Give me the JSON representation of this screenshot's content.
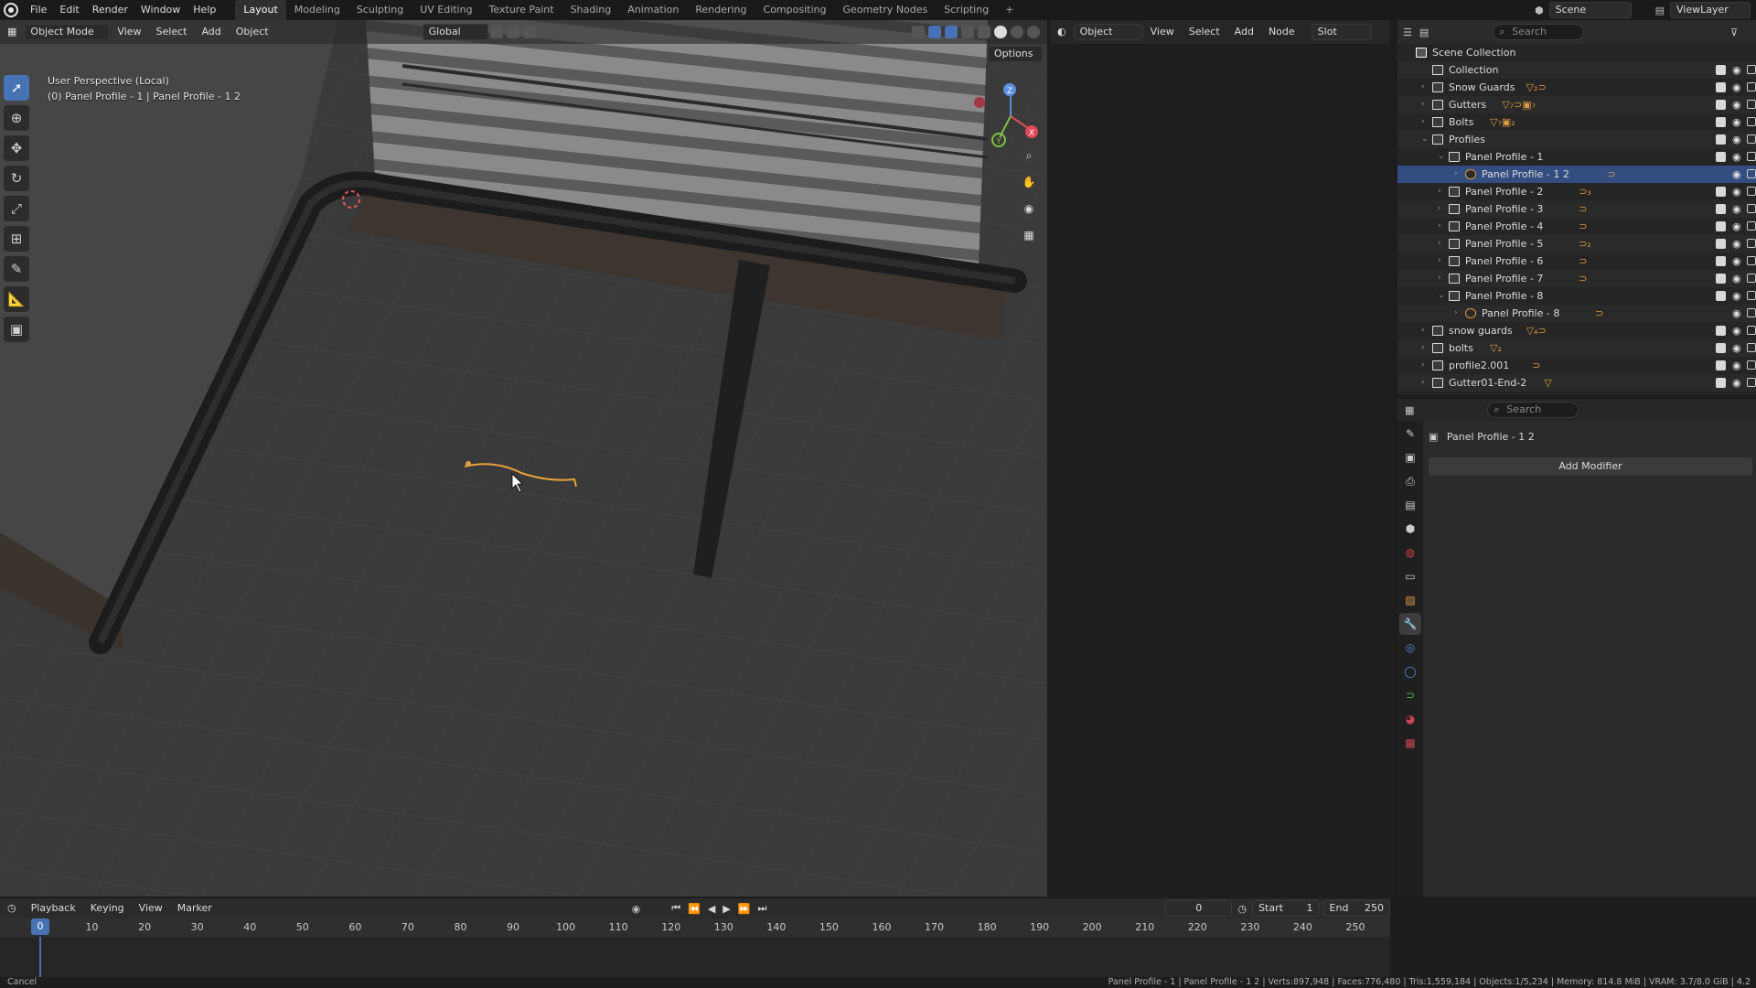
{
  "topbar": {
    "menus": [
      "File",
      "Edit",
      "Render",
      "Window",
      "Help"
    ],
    "workspaces": [
      "Layout",
      "Modeling",
      "Sculpting",
      "UV Editing",
      "Texture Paint",
      "Shading",
      "Animation",
      "Rendering",
      "Compositing",
      "Geometry Nodes",
      "Scripting"
    ],
    "active_workspace": "Layout",
    "add_tab": "+",
    "scene": "Scene",
    "view_layer": "ViewLayer"
  },
  "viewport": {
    "mode": "Object Mode",
    "menus": [
      "View",
      "Select",
      "Add",
      "Object"
    ],
    "orientation": "Global",
    "options": "Options",
    "info_line1": "User Perspective (Local)",
    "info_line2": "(0) Panel Profile - 1 | Panel Profile - 1 2",
    "gizmo_axes": [
      "Z",
      "X",
      "Y"
    ]
  },
  "shader_editor": {
    "object": "Object",
    "menus": [
      "View",
      "Select",
      "Add",
      "Node"
    ],
    "slot": "Slot"
  },
  "outliner": {
    "search_placeholder": "Search",
    "root": "Scene Collection",
    "rows": [
      {
        "label": "Collection",
        "indent": 0,
        "expander": "",
        "extra": "",
        "selected": false
      },
      {
        "label": "Snow Guards",
        "indent": 0,
        "expander": "›",
        "extra": "▽₂⊃",
        "selected": false
      },
      {
        "label": "Gutters",
        "indent": 0,
        "expander": "›",
        "extra": "▽₇⊃▣₇",
        "selected": false
      },
      {
        "label": "Bolts",
        "indent": 0,
        "expander": "›",
        "extra": "▽₇▣₂",
        "selected": false
      },
      {
        "label": "Profiles",
        "indent": 0,
        "expander": "⌄",
        "extra": "",
        "selected": false
      },
      {
        "label": "Panel Profile - 1",
        "indent": 1,
        "expander": "⌄",
        "extra": "",
        "selected": false
      },
      {
        "label": "Panel Profile - 1 2",
        "indent": 2,
        "expander": "›",
        "extra": "⊃",
        "selected": true
      },
      {
        "label": "Panel Profile - 2",
        "indent": 1,
        "expander": "›",
        "extra": "⊃₃",
        "selected": false
      },
      {
        "label": "Panel Profile - 3",
        "indent": 1,
        "expander": "›",
        "extra": "⊃",
        "selected": false
      },
      {
        "label": "Panel Profile - 4",
        "indent": 1,
        "expander": "›",
        "extra": "⊃",
        "selected": false
      },
      {
        "label": "Panel Profile - 5",
        "indent": 1,
        "expander": "›",
        "extra": "⊃₂",
        "selected": false
      },
      {
        "label": "Panel Profile - 6",
        "indent": 1,
        "expander": "›",
        "extra": "⊃",
        "selected": false
      },
      {
        "label": "Panel Profile - 7",
        "indent": 1,
        "expander": "›",
        "extra": "⊃",
        "selected": false
      },
      {
        "label": "Panel Profile - 8",
        "indent": 1,
        "expander": "⌄",
        "extra": "",
        "selected": false
      },
      {
        "label": "Panel Profile - 8",
        "indent": 2,
        "expander": "›",
        "extra": "⊃",
        "selected": false
      },
      {
        "label": "snow guards",
        "indent": 0,
        "expander": "›",
        "extra": "▽₄⊃",
        "selected": false
      },
      {
        "label": "bolts",
        "indent": 0,
        "expander": "›",
        "extra": "▽₂",
        "selected": false
      },
      {
        "label": "profile2.001",
        "indent": 0,
        "expander": "›",
        "extra": "⊃",
        "selected": false
      },
      {
        "label": "Gutter01-End-2",
        "indent": 0,
        "expander": "›",
        "extra": "▽",
        "selected": false
      }
    ]
  },
  "properties": {
    "search_placeholder": "Search",
    "object_name": "Panel Profile - 1 2",
    "add_modifier": "Add Modifier"
  },
  "timeline": {
    "menus": [
      "Playback",
      "Keying",
      "View",
      "Marker"
    ],
    "current_frame": "0",
    "start_label": "Start",
    "start": "1",
    "end_label": "End",
    "end": "250",
    "playhead": "0",
    "ticks": [
      "10",
      "20",
      "30",
      "40",
      "50",
      "60",
      "70",
      "80",
      "90",
      "100",
      "110",
      "120",
      "130",
      "140",
      "150",
      "160",
      "170",
      "180",
      "190",
      "200",
      "210",
      "220",
      "230",
      "240",
      "250"
    ]
  },
  "status": {
    "left": "Cancel",
    "right": "Panel Profile - 1 | Panel Profile - 1 2 | Verts:897,948 | Faces:776,480 | Tris:1,559,184 | Objects:1/5,234 | Memory: 814.8 MiB | VRAM: 3.7/8.0 GiB | 4.2"
  },
  "colors": {
    "accent": "#4772b3",
    "selection": "#334d80",
    "curve": "#e8a13a"
  }
}
